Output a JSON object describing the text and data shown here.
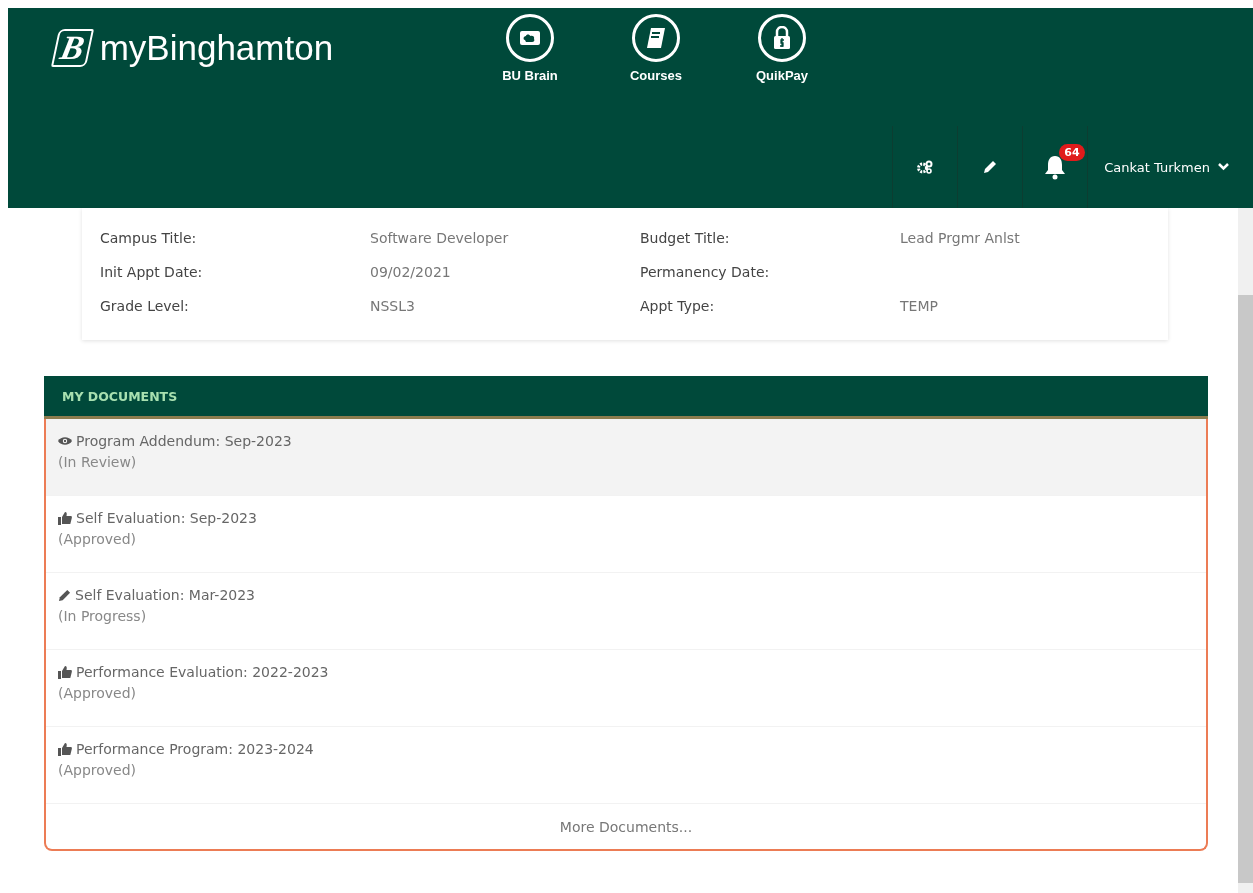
{
  "header": {
    "logo_mark": "B",
    "logo_text": "myBinghamton",
    "nav": [
      {
        "label": "BU Brain"
      },
      {
        "label": "Courses"
      },
      {
        "label": "QuikPay"
      }
    ],
    "tools": [
      {
        "kind": "settings"
      },
      {
        "kind": "edit"
      },
      {
        "kind": "notifications",
        "badge": "64"
      }
    ],
    "user": "Cankat Turkmen"
  },
  "employment": [
    {
      "label": "Campus Title:",
      "value": "Software Developer",
      "label_2": "Budget Title:",
      "value_2": "Lead Prgmr Anlst"
    },
    {
      "label": "Init Appt Date:",
      "value": "09/02/2021",
      "label_2": "Permanency Date:"
    },
    {
      "label": "Grade Level:",
      "value": "NSSL3",
      "label_2": "Appt Type:",
      "value_2": "TEMP"
    }
  ],
  "documents": {
    "title": "MY DOCUMENTS",
    "items": [
      {
        "name": "Program Addendum: Sep-2023",
        "status": "(In Review)",
        "kind": "review",
        "selected": true
      },
      {
        "name": "Self Evaluation: Sep-2023",
        "status": "(Approved)",
        "kind": "approved",
        "selected": false
      },
      {
        "name": "Self Evaluation: Mar-2023",
        "status": "(In Progress)",
        "kind": "progress",
        "selected": false
      },
      {
        "name": "Performance Evaluation: 2022-2023",
        "status": "(Approved)",
        "kind": "approved",
        "selected": false
      },
      {
        "name": "Performance Program: 2023-2024",
        "status": "(Approved)",
        "kind": "approved",
        "selected": false
      }
    ],
    "more": "More Documents..."
  }
}
